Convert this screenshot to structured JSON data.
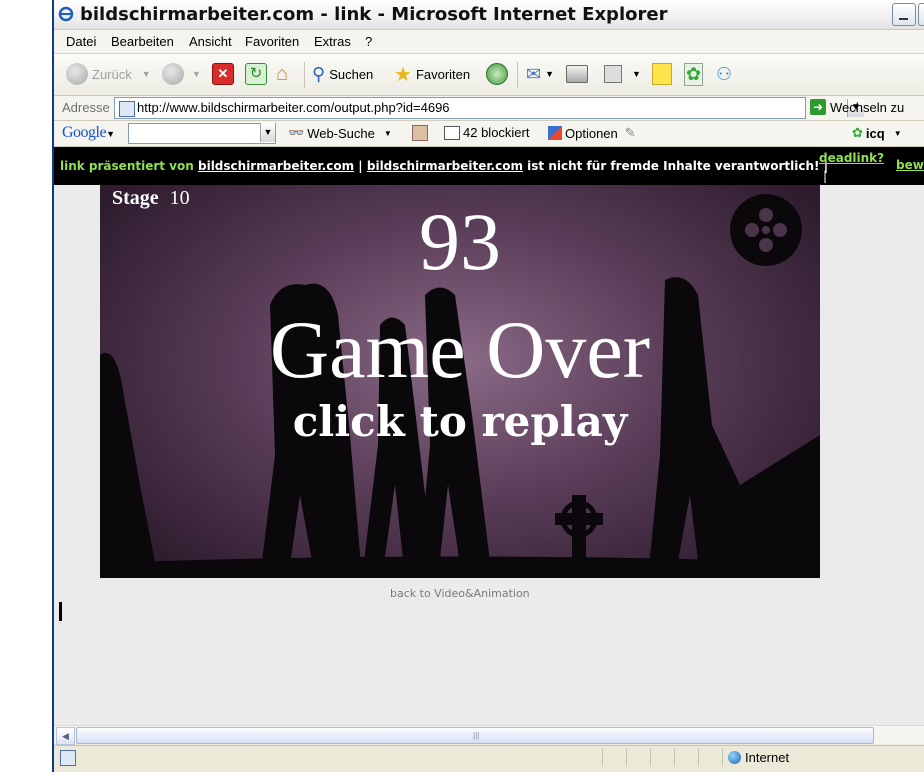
{
  "window": {
    "title": "bildschirmarbeiter.com - link - Microsoft Internet Explorer"
  },
  "menu": [
    "Datei",
    "Bearbeiten",
    "Ansicht",
    "Favoriten",
    "Extras",
    "?"
  ],
  "toolbar": {
    "back": "Zurück",
    "search": "Suchen",
    "favorites": "Favoriten"
  },
  "address": {
    "label": "Adresse",
    "url": "http://www.bildschirmarbeiter.com/output.php?id=4696",
    "go": "Wechseln zu"
  },
  "googlebar": {
    "logo": "Google",
    "search": "Web-Suche",
    "blocked": "42 blockiert",
    "options": "Optionen",
    "icq": "icq"
  },
  "banner": {
    "prefix": "link präsentiert von",
    "site1": "bildschirmarbeiter.com",
    "pipe": "|",
    "site2": "bildschirmarbeiter.com",
    "disclaimer": "ist nicht für fremde Inhalte verantwortlich!",
    "pipe_end": "|",
    "deadlink": "deadlink?",
    "rate": "bew"
  },
  "game": {
    "stage_label": "Stage",
    "stage_value": "10",
    "score": "93",
    "game_over": "Game Over",
    "replay": "click to replay"
  },
  "page": {
    "back_link": "back to Video&Animation"
  },
  "status": {
    "zone": "Internet"
  }
}
